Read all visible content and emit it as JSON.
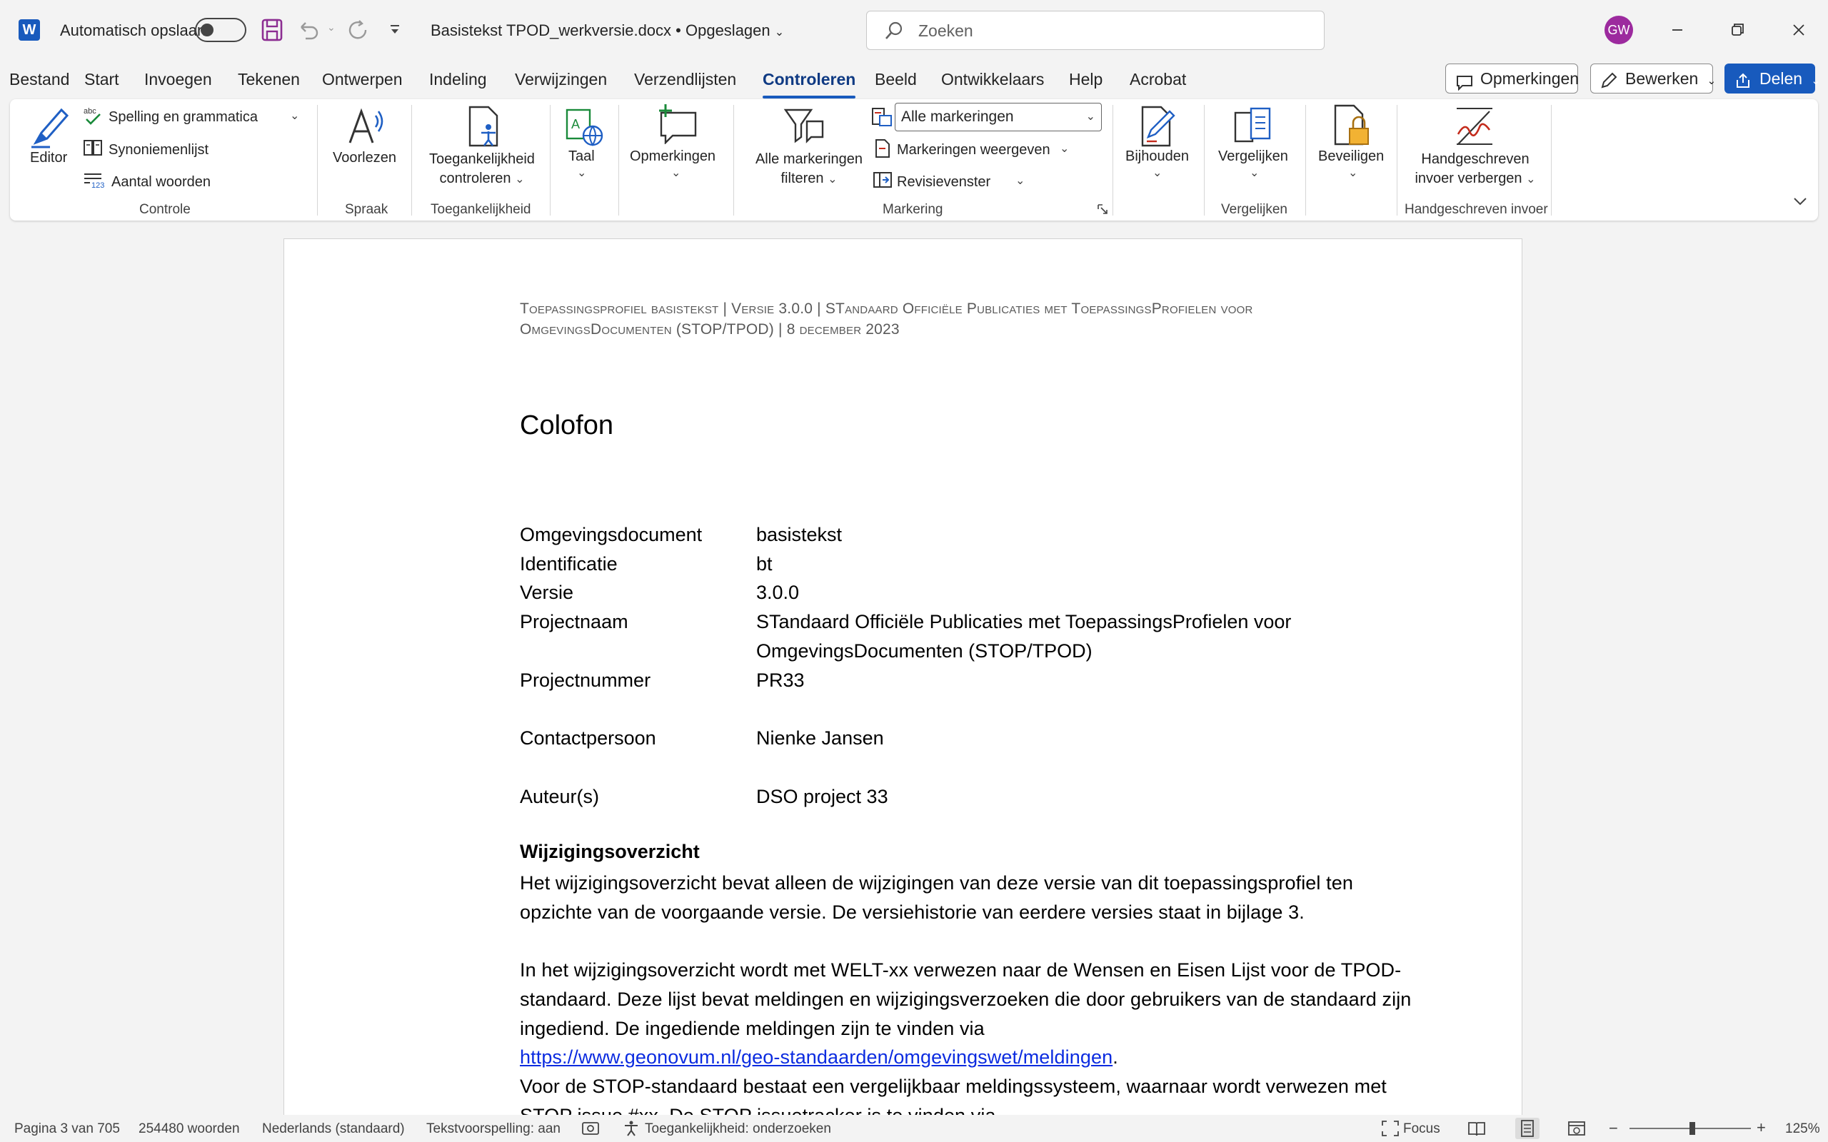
{
  "titlebar": {
    "autosave_label": "Automatisch opslaan",
    "doc_title": "Basistekst TPOD_werkversie.docx",
    "save_state": "Opgeslagen",
    "search_placeholder": "Zoeken",
    "avatar_initials": "GW"
  },
  "menu": {
    "tabs": [
      "Bestand",
      "Start",
      "Invoegen",
      "Tekenen",
      "Ontwerpen",
      "Indeling",
      "Verwijzingen",
      "Verzendlijsten",
      "Controleren",
      "Beeld",
      "Ontwikkelaars",
      "Help",
      "Acrobat"
    ],
    "active_tab": "Controleren",
    "comments_button": "Opmerkingen",
    "edit_button": "Bewerken",
    "share_button": "Delen"
  },
  "ribbon": {
    "proofing": {
      "editor": "Editor",
      "spelling": "Spelling en grammatica",
      "thesaurus": "Synoniemenlijst",
      "word_count": "Aantal woorden",
      "group": "Controle"
    },
    "speech": {
      "read_aloud": "Voorlezen",
      "group": "Spraak"
    },
    "accessibility": {
      "check_line1": "Toegankelijkheid",
      "check_line2": "controleren",
      "group": "Toegankelijkheid"
    },
    "language": {
      "label": "Taal"
    },
    "comments": {
      "label": "Opmerkingen"
    },
    "tracking": {
      "filter_line1": "Alle markeringen",
      "filter_line2": "filteren",
      "markup_select": "Alle markeringen",
      "show_markup": "Markeringen weergeven",
      "reviewing_pane": "Revisievenster",
      "group": "Markering"
    },
    "changes": {
      "label": "Bijhouden"
    },
    "compare": {
      "label": "Vergelijken",
      "group": "Vergelijken"
    },
    "protect": {
      "label": "Beveiligen"
    },
    "ink": {
      "line1": "Handgeschreven",
      "line2": "invoer verbergen",
      "group": "Handgeschreven invoer"
    }
  },
  "document": {
    "header_line1": "Toepassingsprofiel basistekst | Versie 3.0.0 | STandaard Officiële Publicaties met ToepassingsProfielen voor",
    "header_line2": "OmgevingsDocumenten (STOP/TPOD) | 8 december 2023",
    "title": "Colofon",
    "colofon": [
      {
        "key": "Omgevingsdocument",
        "value": "basistekst"
      },
      {
        "key": "Identificatie",
        "value": "bt"
      },
      {
        "key": "Versie",
        "value": "3.0.0"
      },
      {
        "key": "Projectnaam",
        "value": "STandaard Officiële Publicaties met ToepassingsProfielen voor OmgevingsDocumenten (STOP/TPOD)"
      },
      {
        "key": "Projectnummer",
        "value": "PR33"
      },
      {
        "key": "Contactpersoon",
        "value": "Nienke Jansen"
      },
      {
        "key": "Auteur(s)",
        "value": "DSO project 33"
      }
    ],
    "section_heading": "Wijzigingsoverzicht",
    "para1": "Het wijzigingsoverzicht bevat alleen de wijzigingen van deze versie van dit toepassingsprofiel ten opzichte van de voorgaande versie. De versiehistorie van eerdere versies staat in bijlage 3.",
    "para2": "In het wijzigingsoverzicht wordt met WELT-xx verwezen naar de Wensen en Eisen Lijst voor de TPOD-standaard. Deze lijst bevat meldingen en wijzigingsverzoeken die door gebruikers van de standaard zijn ingediend. De ingediende meldingen zijn te vinden via",
    "link": "https://www.geonovum.nl/geo-standaarden/omgevingswet/meldingen",
    "link_suffix": ".",
    "para3": "Voor de STOP-standaard bestaat een vergelijkbaar meldingssysteem, waarnaar wordt verwezen met STOP issue #xx. De STOP issuetracker is te vinden via"
  },
  "statusbar": {
    "page": "Pagina 3 van 705",
    "words": "254480 woorden",
    "language": "Nederlands (standaard)",
    "proofing": "Tekstvoorspelling: aan",
    "accessibility": "Toegankelijkheid: onderzoeken",
    "focus": "Focus",
    "zoom": "125%"
  },
  "colors": {
    "accent": "#185abd",
    "active_tab_text": "#0f3a83",
    "link": "#0b2be0",
    "avatar": "#9c2a9e"
  },
  "icons": [
    "word-logo",
    "save-icon",
    "undo-icon",
    "redo-icon",
    "customize-icon",
    "search-icon",
    "minimize-icon",
    "restore-icon",
    "close-icon",
    "comment-icon",
    "pencil-icon",
    "share-icon",
    "editor-icon",
    "spelling-icon",
    "thesaurus-icon",
    "word-count-icon",
    "read-aloud-icon",
    "accessibility-icon",
    "language-icon",
    "new-comment-icon",
    "filter-icon",
    "markup-icon",
    "reviewing-pane-icon",
    "track-changes-icon",
    "compare-icon",
    "protect-icon",
    "ink-icon",
    "collapse-ribbon-icon",
    "macro-icon",
    "read-mode-icon",
    "print-layout-icon",
    "web-layout-icon"
  ]
}
